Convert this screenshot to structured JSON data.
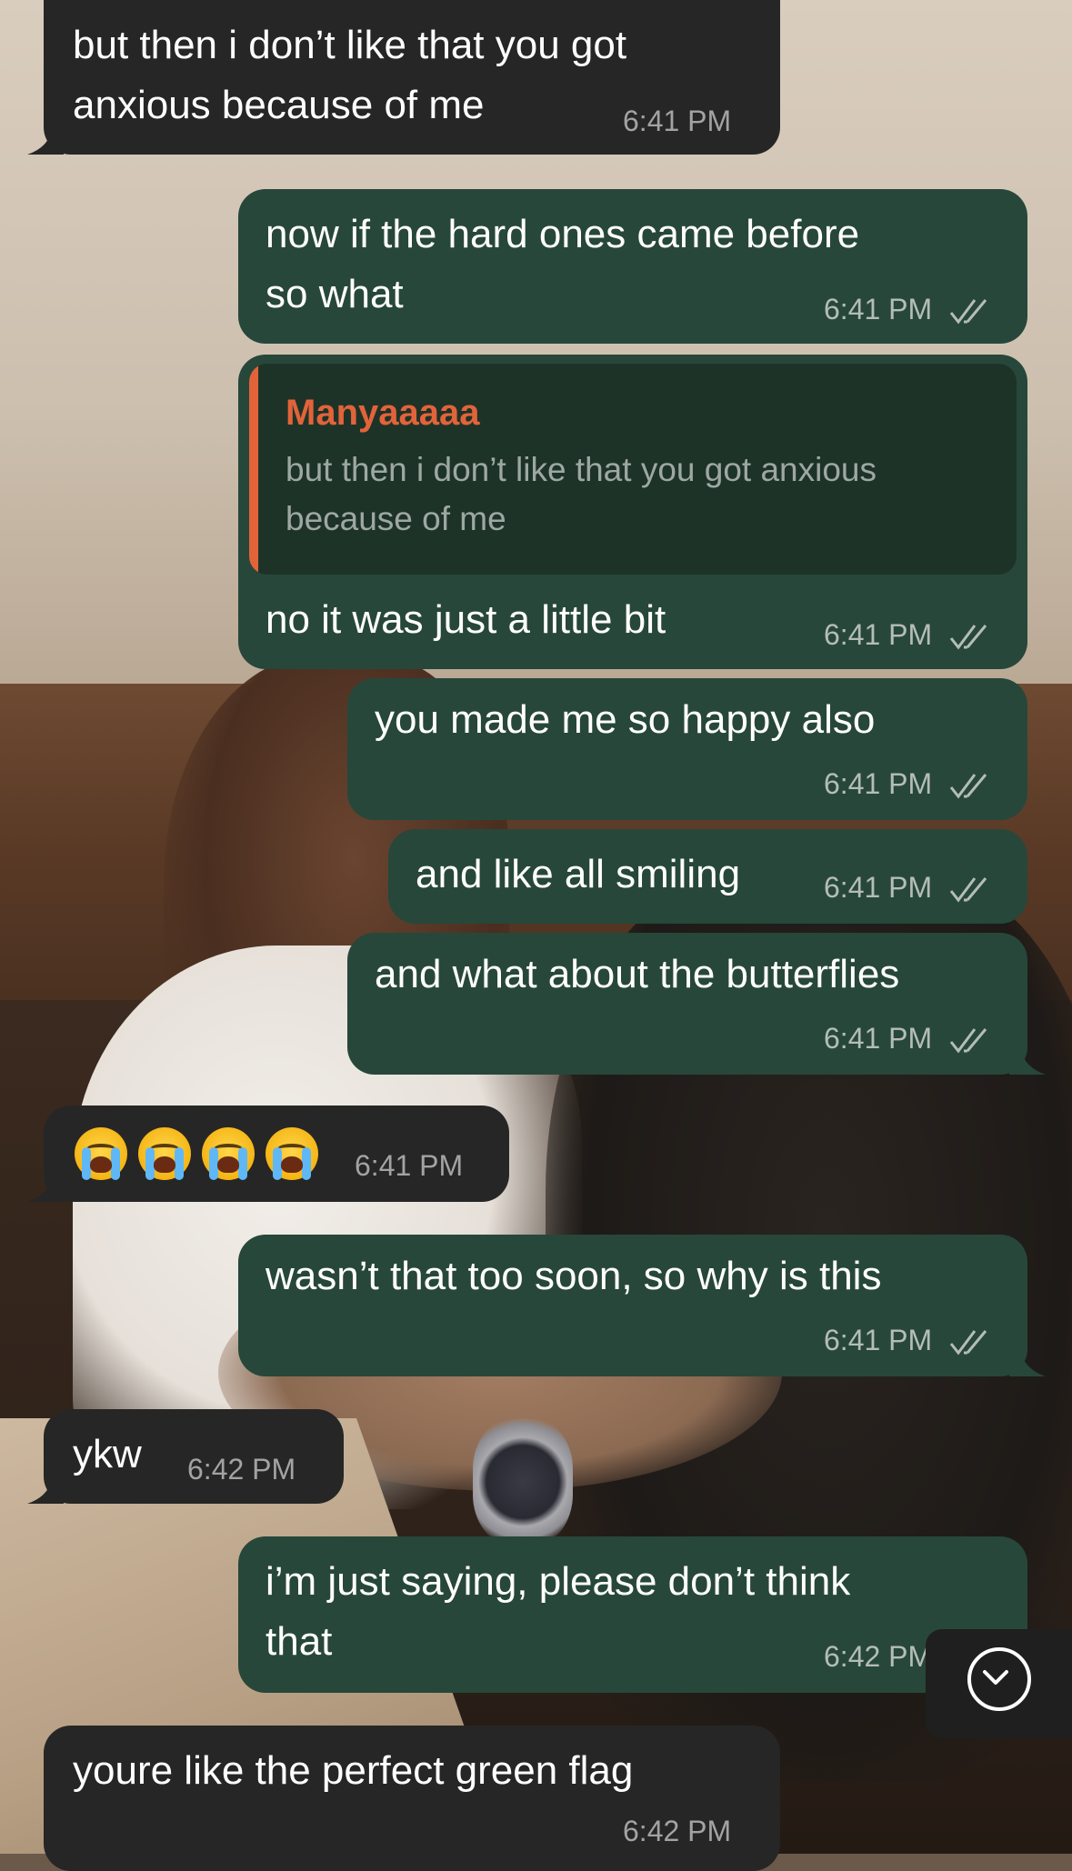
{
  "contact_name": "Manyaaaaa",
  "messages": [
    {
      "id": "m1",
      "direction": "in",
      "lines": [
        "but then i don’t like that you got",
        "anxious because of me"
      ],
      "time": "6:41 PM"
    },
    {
      "id": "m2",
      "direction": "out",
      "lines": [
        "now if the hard ones came before",
        "so what"
      ],
      "time": "6:41 PM",
      "status": "read"
    },
    {
      "id": "m3",
      "direction": "out",
      "reply_to": {
        "name": "Manyaaaaa",
        "lines": [
          "but then i don’t like that you got anxious",
          "because of me"
        ]
      },
      "lines": [
        "no it was just a little bit"
      ],
      "time": "6:41 PM",
      "status": "read"
    },
    {
      "id": "m4",
      "direction": "out",
      "lines": [
        "you made me so happy also"
      ],
      "time": "6:41 PM",
      "status": "read"
    },
    {
      "id": "m5",
      "direction": "out",
      "lines": [
        "and like all smiling"
      ],
      "time": "6:41 PM",
      "status": "read"
    },
    {
      "id": "m6",
      "direction": "out",
      "lines": [
        "and what about the butterflies"
      ],
      "time": "6:41 PM",
      "status": "read"
    },
    {
      "id": "m7",
      "direction": "in",
      "emoji": [
        "loudly-crying-face",
        "loudly-crying-face",
        "loudly-crying-face",
        "loudly-crying-face"
      ],
      "time": "6:41 PM"
    },
    {
      "id": "m8",
      "direction": "out",
      "lines": [
        "wasn’t that too soon, so why is this"
      ],
      "time": "6:41 PM",
      "status": "read"
    },
    {
      "id": "m9",
      "direction": "in",
      "lines": [
        "ykw"
      ],
      "time": "6:42 PM"
    },
    {
      "id": "m10",
      "direction": "out",
      "lines": [
        "i’m just saying, please don’t think",
        "that"
      ],
      "time": "6:42 PM",
      "status": "read"
    },
    {
      "id": "m11",
      "direction": "in",
      "lines": [
        "youre like the perfect green flag"
      ],
      "time": "6:42 PM"
    }
  ],
  "scroll_button": {
    "icon": "chevron-down-circle-icon"
  },
  "colors": {
    "incoming": "#262626",
    "outgoing": "#27473a",
    "quote_name": "#e2633a"
  }
}
